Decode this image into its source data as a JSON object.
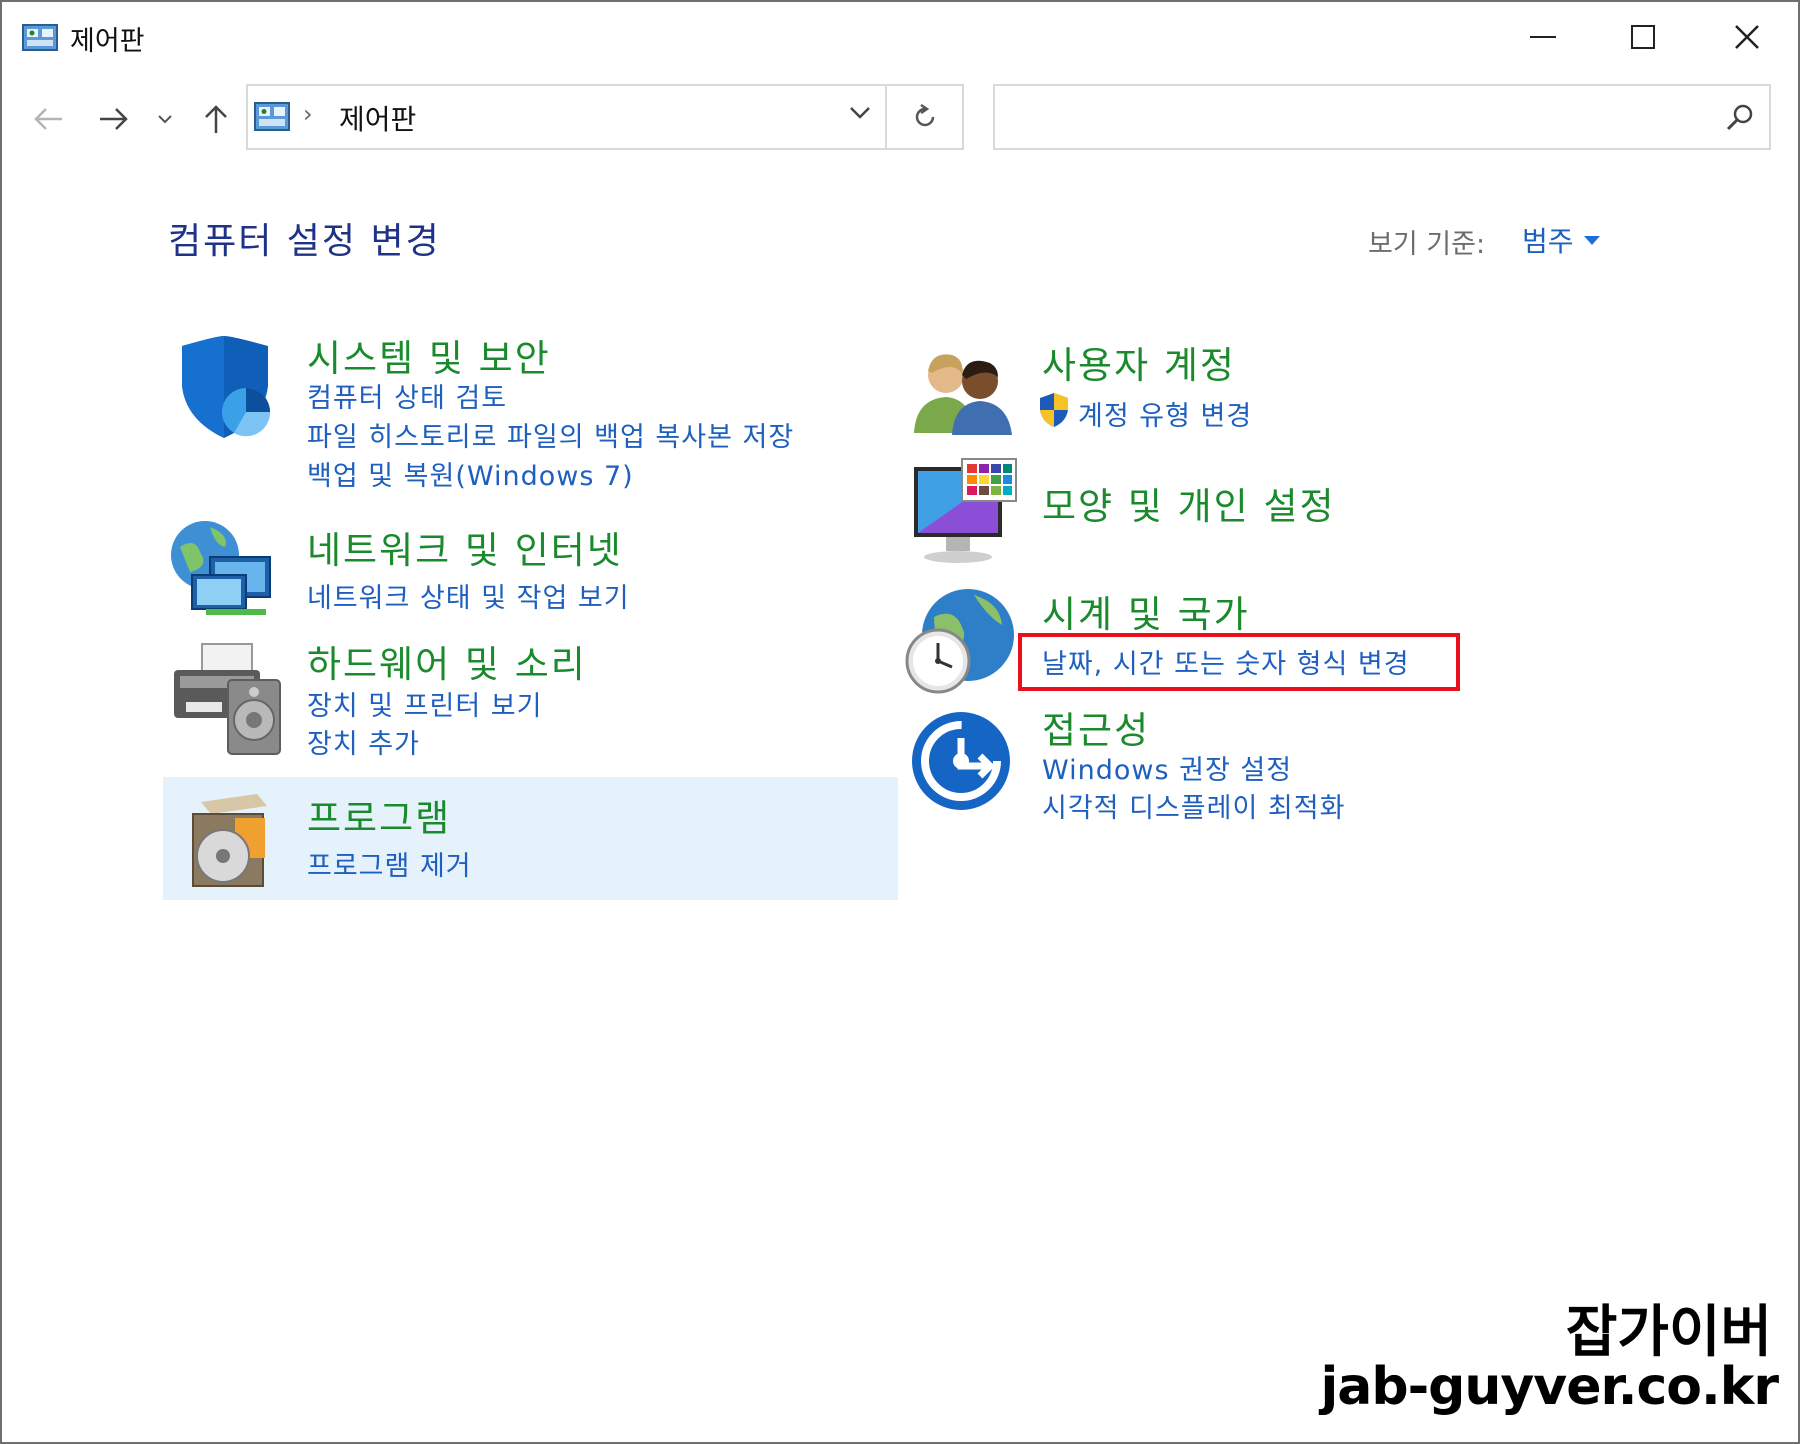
{
  "window": {
    "title": "제어판"
  },
  "address_bar": {
    "path": "제어판",
    "separator": "›"
  },
  "search": {
    "placeholder": ""
  },
  "content": {
    "heading": "컴퓨터 설정 변경",
    "view_by_label": "보기 기준:",
    "view_by_value": "범주"
  },
  "categories": {
    "system": {
      "title": "시스템 및 보안",
      "links": [
        "컴퓨터 상태 검토",
        "파일 히스토리로 파일의 백업 복사본 저장",
        "백업 및 복원(Windows 7)"
      ]
    },
    "network": {
      "title": "네트워크 및 인터넷",
      "links": [
        "네트워크 상태 및 작업 보기"
      ]
    },
    "hardware": {
      "title": "하드웨어 및 소리",
      "links": [
        "장치 및 프린터 보기",
        "장치 추가"
      ]
    },
    "programs": {
      "title": "프로그램",
      "links": [
        "프로그램 제거"
      ]
    },
    "users": {
      "title": "사용자 계정",
      "links": [
        "계정 유형 변경"
      ]
    },
    "appearance": {
      "title": "모양 및 개인 설정",
      "links": []
    },
    "clock": {
      "title": "시계 및 국가",
      "links": [
        "날짜, 시간 또는 숫자 형식 변경"
      ]
    },
    "access": {
      "title": "접근성",
      "links": [
        "Windows 권장 설정",
        "시각적 디스플레이 최적화"
      ]
    }
  },
  "watermark": {
    "line1": "잡가이버",
    "line2": "jab-guyver.co.kr"
  },
  "colors": {
    "category_title": "#1a8a2c",
    "link": "#1e5fbf",
    "heading": "#1e3287",
    "highlight": "#e5f1fb",
    "annotation": "#e8101a"
  }
}
